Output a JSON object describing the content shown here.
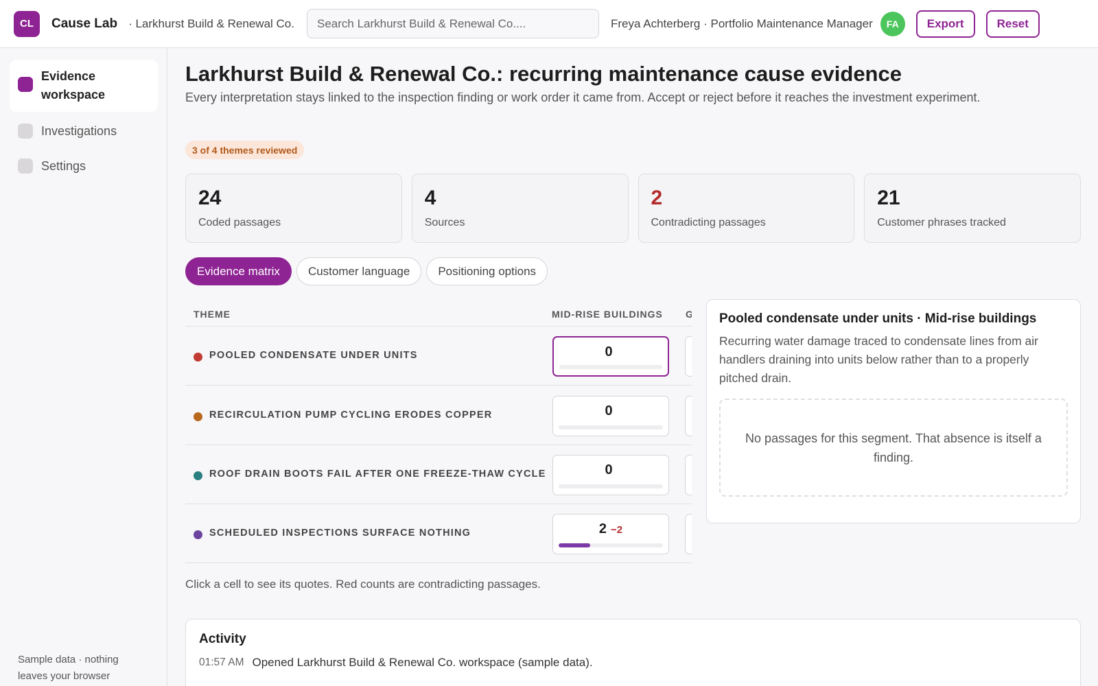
{
  "header": {
    "logo_initials": "CL",
    "app_name": "Cause Lab",
    "org_name": "· Larkhurst Build & Renewal Co.",
    "search_placeholder": "Search Larkhurst Build & Renewal Co....",
    "user_label": "Freya Achterberg · Portfolio Maintenance Manager",
    "avatar_initials": "FA",
    "export_label": "Export",
    "reset_label": "Reset"
  },
  "sidebar": {
    "items": [
      {
        "label": "Evidence workspace",
        "active": true
      },
      {
        "label": "Investigations",
        "active": false
      },
      {
        "label": "Settings",
        "active": false
      }
    ],
    "footer": "Sample data · nothing leaves your browser"
  },
  "main": {
    "title": "Larkhurst Build & Renewal Co.: recurring maintenance cause evidence",
    "description": "Every interpretation stays linked to the inspection finding or work order it came from. Accept or reject before it reaches the investment experiment.",
    "review_status": "3 of 4 themes reviewed",
    "stats": [
      {
        "value": "24",
        "label": "Coded passages"
      },
      {
        "value": "4",
        "label": "Sources"
      },
      {
        "value": "2",
        "label": "Contradicting passages"
      },
      {
        "value": "21",
        "label": "Customer phrases tracked"
      }
    ],
    "tabs": [
      {
        "label": "Evidence matrix",
        "active": true
      },
      {
        "label": "Customer language",
        "active": false
      },
      {
        "label": "Positioning options",
        "active": false
      }
    ],
    "matrix": {
      "columns": [
        "THEME",
        "MID-RISE BUILDINGS",
        "G"
      ],
      "rows": [
        {
          "theme": "POOLED CONDENSATE UNDER UNITS",
          "color": "#c23b32",
          "count": "0",
          "contradict": "",
          "fill": 0
        },
        {
          "theme": "RECIRCULATION PUMP CYCLING ERODES COPPER",
          "color": "#b8691e",
          "count": "0",
          "contradict": "",
          "fill": 0
        },
        {
          "theme": "ROOF DRAIN BOOTS FAIL AFTER ONE FREEZE-THAW CYCLE",
          "color": "#2a7f80",
          "count": "0",
          "contradict": "",
          "fill": 0
        },
        {
          "theme": "SCHEDULED INSPECTIONS SURFACE NOTHING",
          "color": "#6b44a0",
          "count": "2",
          "contradict": "−2",
          "fill": 0.3
        }
      ],
      "note": "Click a cell to see its quotes. Red counts are contradicting passages."
    },
    "detail": {
      "title": "Pooled condensate under units · Mid-rise buildings",
      "description": "Recurring water damage traced to condensate lines from air handlers draining into units below rather than to a properly pitched drain.",
      "empty_message": "No passages for this segment. That absence is itself a finding."
    },
    "activity": {
      "title": "Activity",
      "entries": [
        {
          "time": "01:57 AM",
          "text": "Opened Larkhurst Build & Renewal Co. workspace (sample data)."
        }
      ]
    }
  }
}
